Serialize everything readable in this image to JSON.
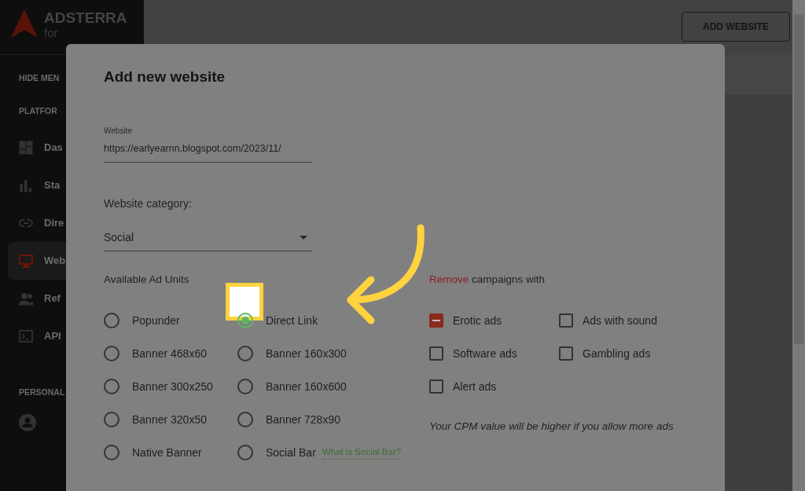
{
  "sidebar": {
    "logo": {
      "name": "ADSTERRA",
      "sub": "for"
    },
    "hide_menu": "HIDE MEN",
    "section_label": "PLATFOR",
    "items": [
      {
        "label": "Das",
        "selected": false
      },
      {
        "label": "Sta",
        "selected": false
      },
      {
        "label": "Dire",
        "selected": false
      },
      {
        "label": "Web",
        "selected": true
      },
      {
        "label": "Ref",
        "selected": false
      },
      {
        "label": "API",
        "selected": false
      }
    ],
    "personal_label": "PERSONAL"
  },
  "header": {
    "button": "ADD WEBSITE"
  },
  "modal": {
    "title": "Add new website",
    "website_field": {
      "label": "Website",
      "value": "https://earlyearnn.blogspot.com/2023/11/"
    },
    "category": {
      "label": "Website category:",
      "value": "Social"
    },
    "ad_units": {
      "title": "Available Ad Units",
      "options": [
        {
          "label": "Popunder",
          "selected": false
        },
        {
          "label": "Direct Link",
          "selected": true
        },
        {
          "label": "Banner 468x60",
          "selected": false
        },
        {
          "label": "Banner 160x300",
          "selected": false
        },
        {
          "label": "Banner 300x250",
          "selected": false
        },
        {
          "label": "Banner 160x600",
          "selected": false
        },
        {
          "label": "Banner 320x50",
          "selected": false
        },
        {
          "label": "Banner 728x90",
          "selected": false
        },
        {
          "label": "Native Banner",
          "selected": false
        },
        {
          "label": "Social Bar",
          "selected": false,
          "help_link": "What is Social Bar?"
        }
      ]
    },
    "remove": {
      "title_highlight": "Remove",
      "title_rest": "campaigns with",
      "options": [
        {
          "label": "Erotic ads",
          "checked": true
        },
        {
          "label": "Ads with sound",
          "checked": false
        },
        {
          "label": "Software ads",
          "checked": false
        },
        {
          "label": "Gambling ads",
          "checked": false
        },
        {
          "label": "Alert ads",
          "checked": false
        }
      ],
      "note": "Your CPM value will be higher if you allow more ads"
    }
  }
}
